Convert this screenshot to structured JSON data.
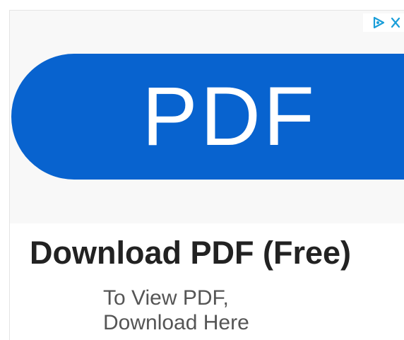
{
  "ad": {
    "image": {
      "label": "PDF",
      "pill_color": "#0863cf",
      "text_color": "#ffffff",
      "background": "#f8f8f8"
    },
    "adchoices": {
      "icon": "adchoices-icon",
      "close_icon": "close-icon",
      "color": "#1a9ed9"
    },
    "headline": "Download PDF (Free)",
    "body_lines": [
      "To View PDF,",
      "Download Here"
    ]
  }
}
